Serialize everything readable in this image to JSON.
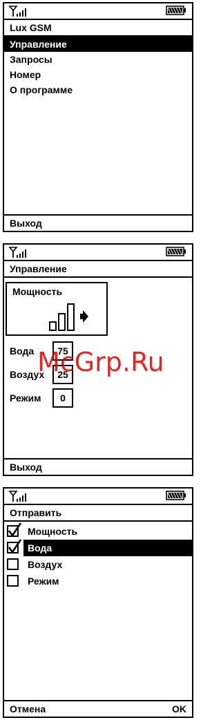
{
  "screen1": {
    "title": "Lux GSM",
    "menu": [
      "Управление",
      "Запросы",
      "Номер",
      "О программе"
    ],
    "selected": 0,
    "soft_left": "Выход"
  },
  "screen2": {
    "title": "Управление",
    "power_label": "Мощность",
    "params": [
      {
        "label": "Вода",
        "value": "75"
      },
      {
        "label": "Воздух",
        "value": "25"
      },
      {
        "label": "Режим",
        "value": "0"
      }
    ],
    "soft_left": "Выход",
    "watermark": "McGrp.Ru"
  },
  "screen3": {
    "title": "Отправить",
    "items": [
      {
        "label": "Мощность",
        "checked": true
      },
      {
        "label": "Вода",
        "checked": true
      },
      {
        "label": "Воздух",
        "checked": false
      },
      {
        "label": "Режим",
        "checked": false
      }
    ],
    "selected": 1,
    "soft_left": "Отмена",
    "soft_right": "OK"
  },
  "icons": {
    "signal": "antenna-signal-icon",
    "battery": "battery-icon",
    "power_level": "power-level-bars-icon",
    "checkmark": "checkmark-icon"
  }
}
